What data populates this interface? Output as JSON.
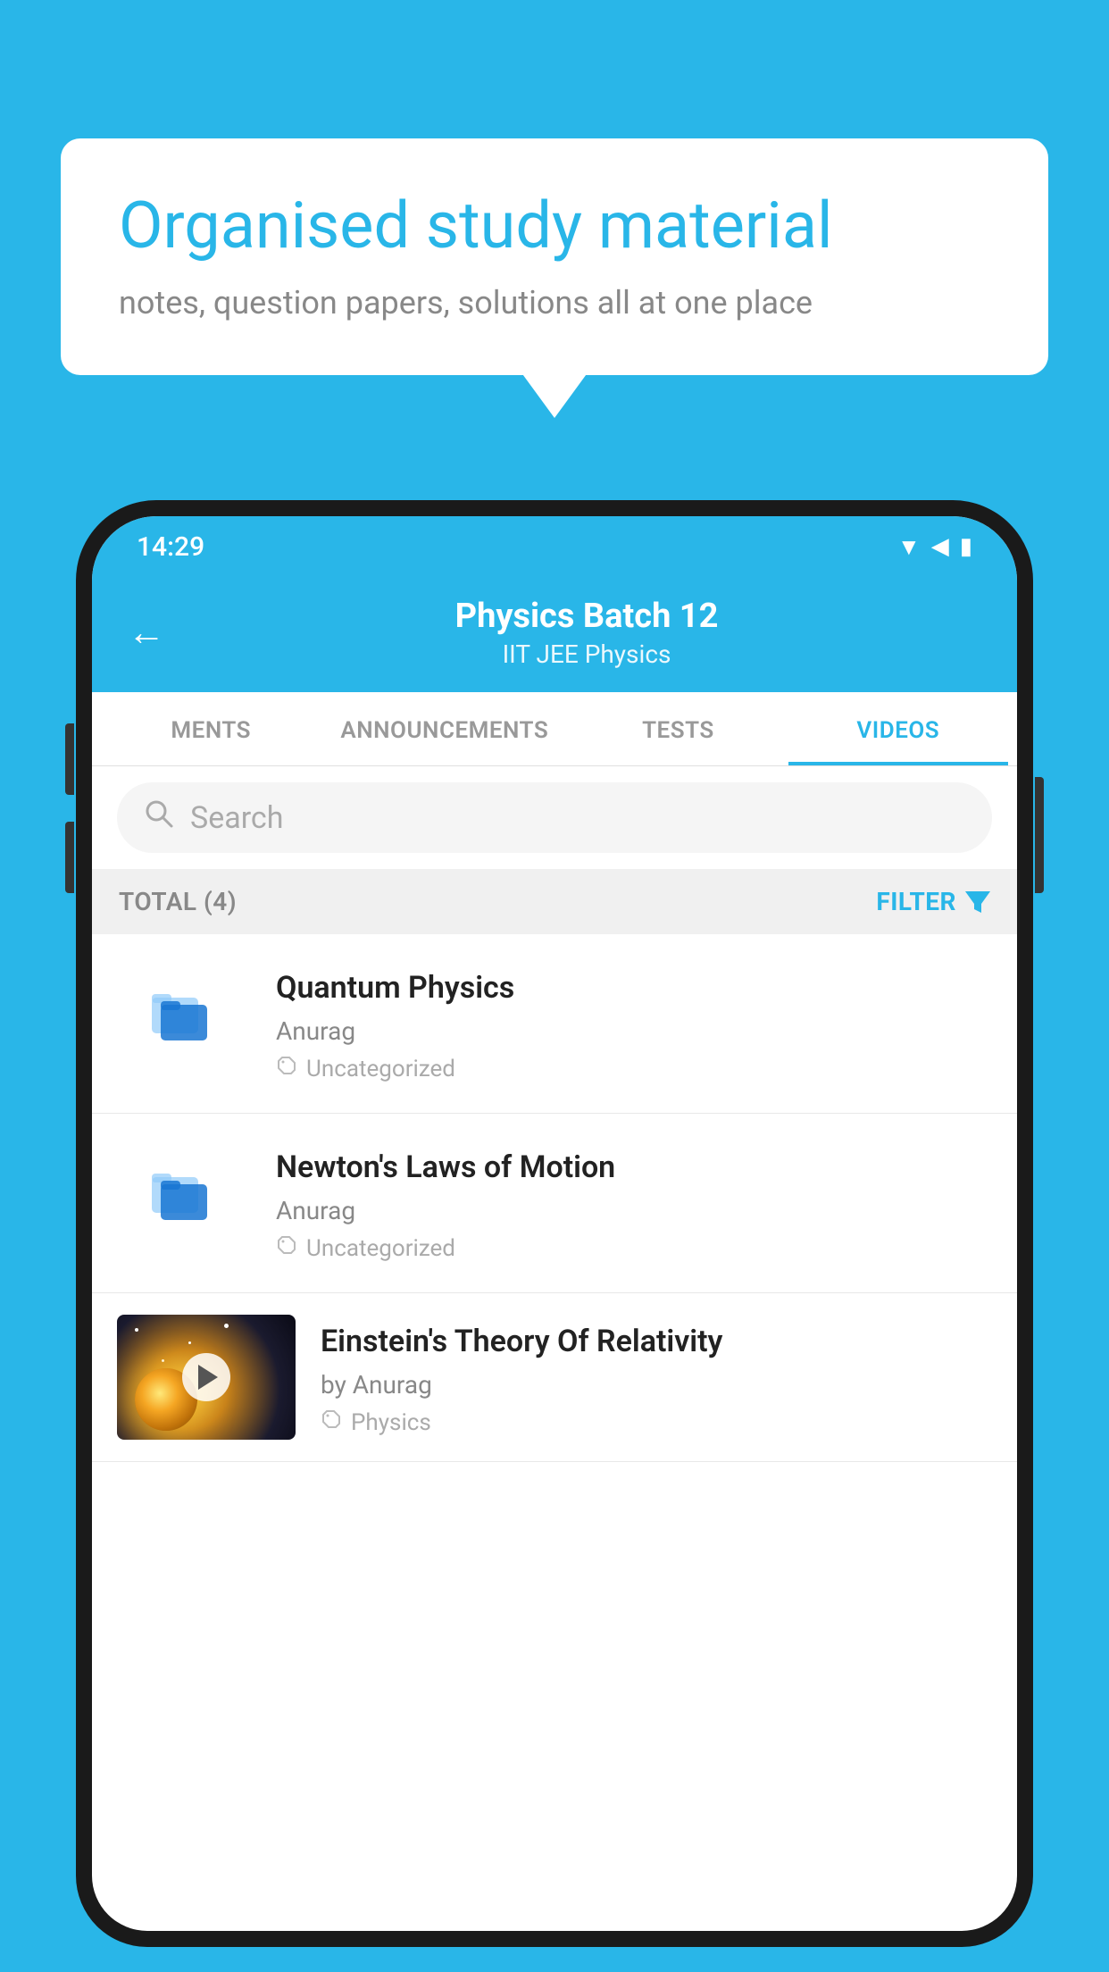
{
  "app": {
    "background_color": "#29b6e8"
  },
  "speech_bubble": {
    "title": "Organised study material",
    "subtitle": "notes, question papers, solutions all at one place"
  },
  "phone": {
    "status_bar": {
      "time": "14:29",
      "icons": [
        "wifi",
        "signal",
        "battery"
      ]
    },
    "header": {
      "back_label": "←",
      "title": "Physics Batch 12",
      "tags": "IIT JEE   Physics"
    },
    "tabs": [
      {
        "label": "MENTS",
        "active": false
      },
      {
        "label": "ANNOUNCEMENTS",
        "active": false
      },
      {
        "label": "TESTS",
        "active": false
      },
      {
        "label": "VIDEOS",
        "active": true
      }
    ],
    "search": {
      "placeholder": "Search"
    },
    "filter_bar": {
      "total_label": "TOTAL (4)",
      "filter_label": "FILTER"
    },
    "videos": [
      {
        "id": 1,
        "title": "Quantum Physics",
        "author": "Anurag",
        "tag": "Uncategorized",
        "has_thumbnail": false
      },
      {
        "id": 2,
        "title": "Newton's Laws of Motion",
        "author": "Anurag",
        "tag": "Uncategorized",
        "has_thumbnail": false
      },
      {
        "id": 3,
        "title": "Einstein's Theory Of Relativity",
        "author": "by Anurag",
        "tag": "Physics",
        "has_thumbnail": true
      }
    ]
  }
}
